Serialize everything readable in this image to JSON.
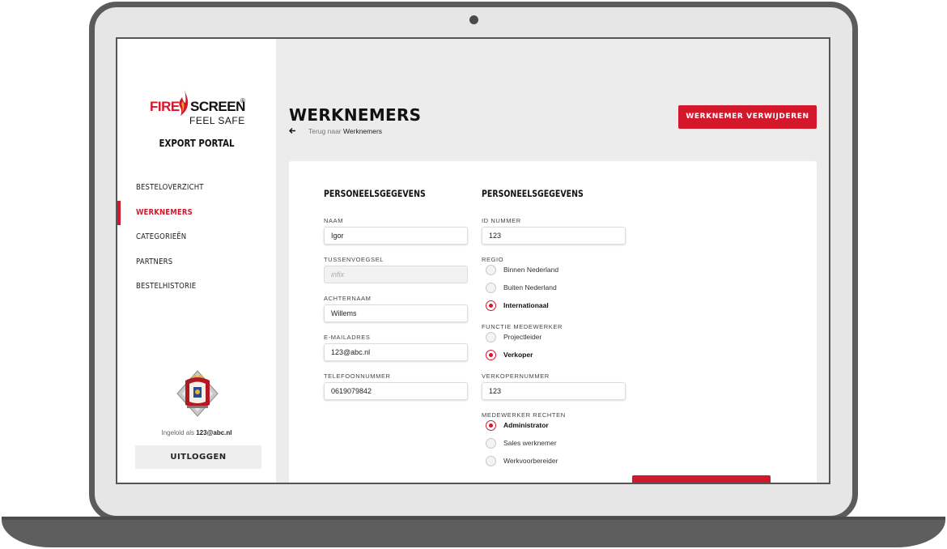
{
  "brand": {
    "fire": "FIRE",
    "screen": "SCREEN",
    "registered": "®",
    "tagline": "FEEL SAFE",
    "portal_name": "EXPORT PORTAL",
    "accent_color": "#d4182c"
  },
  "sidebar": {
    "items": [
      {
        "label": "BESTELOVERZICHT",
        "active": false
      },
      {
        "label": "WERKNEMERS",
        "active": true
      },
      {
        "label": "CATEGORIEËN",
        "active": false
      },
      {
        "label": "PARTNERS",
        "active": false
      },
      {
        "label": "BESTELHISTORIE",
        "active": false
      }
    ],
    "logged_in_prefix": "Ingelold als",
    "logged_in_user": "123@abc.nl",
    "logout_label": "UITLOGGEN"
  },
  "header": {
    "title": "WERKNEMERS",
    "back_icon": "arrow-left-icon",
    "breadcrumb_prefix": "Terug naar",
    "breadcrumb_target": "Werknemers",
    "delete_label": "WERKNEMER VERWIJDEREN"
  },
  "form": {
    "left": {
      "title": "PERSONEELSGEGEVENS",
      "fields": {
        "naam": {
          "label": "NAAM",
          "value": "Igor"
        },
        "tussenvoegsel": {
          "label": "TUSSENVOEGSEL",
          "placeholder": "infix"
        },
        "achternaam": {
          "label": "ACHTERNAAM",
          "value": "Willems"
        },
        "email": {
          "label": "E-MAILADRES",
          "value": "123@abc.nl"
        },
        "telefoon": {
          "label": "TELEFOONNUMMER",
          "value": "0619079842"
        }
      }
    },
    "right": {
      "title": "PERSONEELSGEGEVENS",
      "id_label": "ID NUMMER",
      "id_value": "123",
      "regio_label": "REGIO",
      "regio_options": [
        "Binnen Nederland",
        "Buiten Nederland",
        "Internationaal"
      ],
      "regio_selected": "Internationaal",
      "functie_label": "FUNCTIE MEDEWERKER",
      "functie_options": [
        "Projectleider",
        "Verkoper"
      ],
      "functie_selected": "Verkoper",
      "verkoper_label": "VERKOPERNUMMER",
      "verkoper_value": "123",
      "rechten_label": "MEDEWERKER RECHTEN",
      "rechten_options": [
        "Administrator",
        "Sales werknemer",
        "Werkvoorbereider"
      ],
      "rechten_selected": "Administrator"
    }
  }
}
